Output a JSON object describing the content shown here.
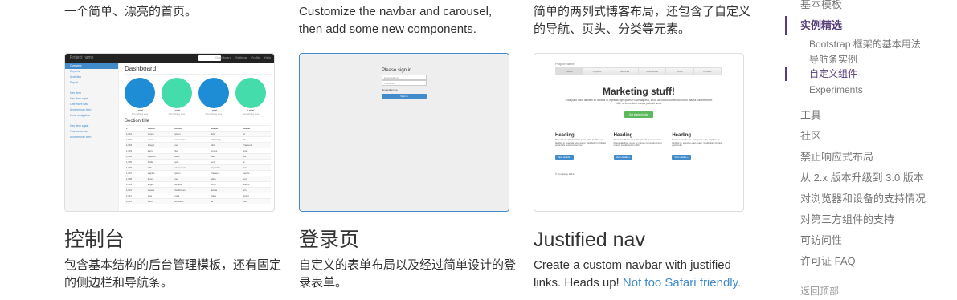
{
  "cards": [
    {
      "top_desc": "一个简单、漂亮的首页。",
      "title": "控制台",
      "desc_lines": [
        "包含基本结构的后台管理模板，还有固定",
        "的侧边栏和导航条。"
      ],
      "preview": {
        "brand": "Project name",
        "menu": [
          "Dashboard",
          "Settings",
          "Profile",
          "Help"
        ],
        "sidebar": [
          "Overview",
          "Reports",
          "Analytics",
          "Export",
          "",
          "Nav item",
          "Nav item again",
          "One more nav",
          "Another nav item",
          "More navigation",
          "",
          "Nav item again",
          "One more nav",
          "Another nav item"
        ],
        "heading": "Dashboard",
        "placeholders": [
          {
            "label": "Label",
            "sub": "Something else",
            "color": "#1f8dd6"
          },
          {
            "label": "Label",
            "sub": "Something else",
            "color": "#44dcab"
          },
          {
            "label": "Label",
            "sub": "Something else",
            "color": "#1f8dd6"
          },
          {
            "label": "Label",
            "sub": "Something else",
            "color": "#44dcab"
          }
        ],
        "section_title": "Section title",
        "table_header": [
          "#",
          "Header",
          "Header",
          "Header",
          "Header"
        ],
        "table_rows": [
          [
            "1,001",
            "Lorem",
            "ipsum",
            "dolor",
            "sit"
          ],
          [
            "1,002",
            "amet",
            "consectetur",
            "adipiscing",
            "elit"
          ],
          [
            "1,003",
            "Integer",
            "nec",
            "odio",
            "Praesent"
          ],
          [
            "1,003",
            "libero",
            "Sed",
            "cursus",
            "ante"
          ],
          [
            "1,004",
            "dapibus",
            "diam",
            "Sed",
            "nisi"
          ],
          [
            "1,005",
            "Nulla",
            "quis",
            "sem",
            "at"
          ],
          [
            "1,006",
            "nibh",
            "elementum",
            "imperdiet",
            "Duis"
          ],
          [
            "1,007",
            "sagittis",
            "ipsum",
            "Praesent",
            "mauris"
          ],
          [
            "1,008",
            "Fusce",
            "nec",
            "tellus",
            "sed"
          ],
          [
            "1,009",
            "augue",
            "semper",
            "porta",
            "Mauris"
          ],
          [
            "1,010",
            "massa",
            "Vestibulum",
            "lacinia",
            "arcu"
          ],
          [
            "1,011",
            "eget",
            "nulla",
            "Class",
            "aptent"
          ],
          [
            "1,012",
            "taciti",
            "sociosqu",
            "ad",
            "litora"
          ]
        ]
      }
    },
    {
      "top_desc_lines": [
        "Customize the navbar and carousel,",
        "then add some new components."
      ],
      "title": "登录页",
      "desc_lines": [
        "自定义的表单布局以及经过简单设计的登",
        "录表单。"
      ],
      "preview": {
        "heading": "Please sign in",
        "email_placeholder": "Email address",
        "password_placeholder": "Password",
        "remember": "Remember me",
        "button": "Sign in"
      }
    },
    {
      "top_desc_lines": [
        "简单的两列式博客布局，还包含了自定义",
        "的导航、页头、分类等元素。"
      ],
      "title": "Justified nav",
      "desc_prefix": "Create a custom navbar with justified",
      "desc_line2": "links. Heads up! ",
      "desc_link": "Not too Safari friendly.",
      "preview": {
        "brand": "Project name",
        "nav": [
          "Home",
          "Projects",
          "Services",
          "Downloads",
          "About",
          "Contact"
        ],
        "heading": "Marketing stuff!",
        "lead": "Cras justo odio, dapibus ac facilisis in, egestas eget quam. Fusce dapibus, tellus ac cursus commodo, tortor mauris condimentum nibh, ut fermentum massa justo sit amet.",
        "cta": "Get started today",
        "columns": [
          {
            "title": "Heading",
            "text": "Donec sed odio dui. Cras justo odio, dapibus ac facilisis in, egestas eget quam. Vestibulum id ligula porta felis euismod semper.",
            "button": "View details »"
          },
          {
            "title": "Heading",
            "text": "Donec id elit non mi porta gravida at eget metus. Fusce dapibus, tellus ac cursus commodo, tortor mauris condimentum nibh.",
            "button": "View details »"
          },
          {
            "title": "Heading",
            "text": "Donec sed odio dui. Cras justo odio, dapibus ac facilisis in, egestas eget quam. Vestibulum id ligula porta felis.",
            "button": "View details »"
          }
        ],
        "footer": "© Company 2014"
      }
    }
  ],
  "sidenav": {
    "items": [
      {
        "label": "基本模板",
        "active": false
      },
      {
        "label": "实例精选",
        "active": true
      },
      {
        "label": "Bootstrap 框架的基本用法",
        "sub": true,
        "active": false
      },
      {
        "label": "导航条实例",
        "sub": true,
        "active": false
      },
      {
        "label": "自定义组件",
        "sub": true,
        "active": true
      },
      {
        "label": "Experiments",
        "sub": true,
        "active": false
      },
      {
        "label": "工具",
        "active": false
      },
      {
        "label": "社区",
        "active": false
      },
      {
        "label": "禁止响应式布局",
        "active": false
      },
      {
        "label": "从 2.x 版本升级到 3.0 版本",
        "active": false
      },
      {
        "label": "对浏览器和设备的支持情况",
        "active": false
      },
      {
        "label": "对第三方组件的支持",
        "active": false
      },
      {
        "label": "可访问性",
        "active": false
      },
      {
        "label": "许可证 FAQ",
        "active": false
      }
    ],
    "back_to_top": "返回顶部",
    "accent_color": "#563d7c"
  }
}
